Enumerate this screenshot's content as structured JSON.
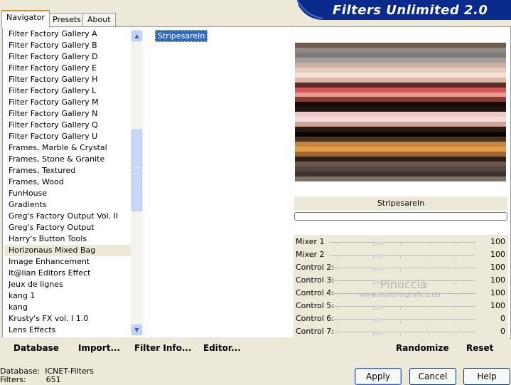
{
  "tabs": [
    "Navigator",
    "Presets",
    "About"
  ],
  "banner_title": "Filters Unlimited 2.0",
  "categories": [
    "Filter Factory Gallery A",
    "Filter Factory Gallery B",
    "Filter Factory Gallery D",
    "Filter Factory Gallery E",
    "Filter Factory Gallery H",
    "Filter Factory Gallery L",
    "Filter Factory Gallery M",
    "Filter Factory Gallery N",
    "Filter Factory Gallery Q",
    "Filter Factory Gallery U",
    "Frames, Marble & Crystal",
    "Frames, Stone & Granite",
    "Frames, Textured",
    "Frames, Wood",
    "FunHouse",
    "Gradients",
    "Greg's Factory Output Vol. II",
    "Greg's Factory Output",
    "Harry's Button Tools",
    "Horizonaus Mixed Bag",
    "Image Enhancement",
    "It@lian Editors Effect",
    "Jeux de lignes",
    "kang 1",
    "kang",
    "Krusty's FX vol. I 1.0",
    "Lens Effects"
  ],
  "selected_category": "Horizonaus Mixed Bag",
  "filters": [
    "StripesareIn"
  ],
  "preview_name": "StripesareIn",
  "preview_stripes": [
    "#6e5a4c",
    "#8f8b89",
    "#7d7a78",
    "#a29e9b",
    "#c7b0a0",
    "#e7cdb8",
    "#f3e3d6",
    "#d8b9a6",
    "#5b2f28",
    "#d75757",
    "#e99a92",
    "#8a3a33",
    "#170b07",
    "#1f1412",
    "#efc9c4",
    "#f6dcdc",
    "#d3a39a",
    "#2a1c14",
    "#0b0503",
    "#4a3425",
    "#c1863f",
    "#e09a4a",
    "#a46630",
    "#2c1e16",
    "#6a574c",
    "#544841",
    "#3d332d",
    "#7b726a"
  ],
  "sliders": [
    {
      "label": "Mixer 1",
      "value": "100"
    },
    {
      "label": "Mixer 2",
      "value": "100"
    },
    {
      "label": "Control 2:",
      "value": "100"
    },
    {
      "label": "Control 3:",
      "value": "100"
    },
    {
      "label": "Control 4:",
      "value": "100"
    },
    {
      "label": "Control 5:",
      "value": "100"
    },
    {
      "label": "Control 6:",
      "value": "0"
    },
    {
      "label": "Control 7:",
      "value": "0"
    }
  ],
  "bottom_buttons": {
    "database": "Database",
    "import": "Import...",
    "filter_info": "Filter Info...",
    "editor": "Editor...",
    "randomize": "Randomize",
    "reset": "Reset"
  },
  "status": {
    "database_label": "Database:",
    "database_value": "ICNET-Filters",
    "filters_label": "Filters:",
    "filters_value": "651"
  },
  "dialog_buttons": {
    "apply": "Apply",
    "cancel": "Cancel",
    "help": "Help"
  },
  "watermark": {
    "name": "Pinuccia",
    "site": "www.maidiregrafica.eu"
  },
  "colors": {
    "banner": "#0a2a8c",
    "selection": "#316ac5",
    "tab_accent": "#e68b2c"
  }
}
